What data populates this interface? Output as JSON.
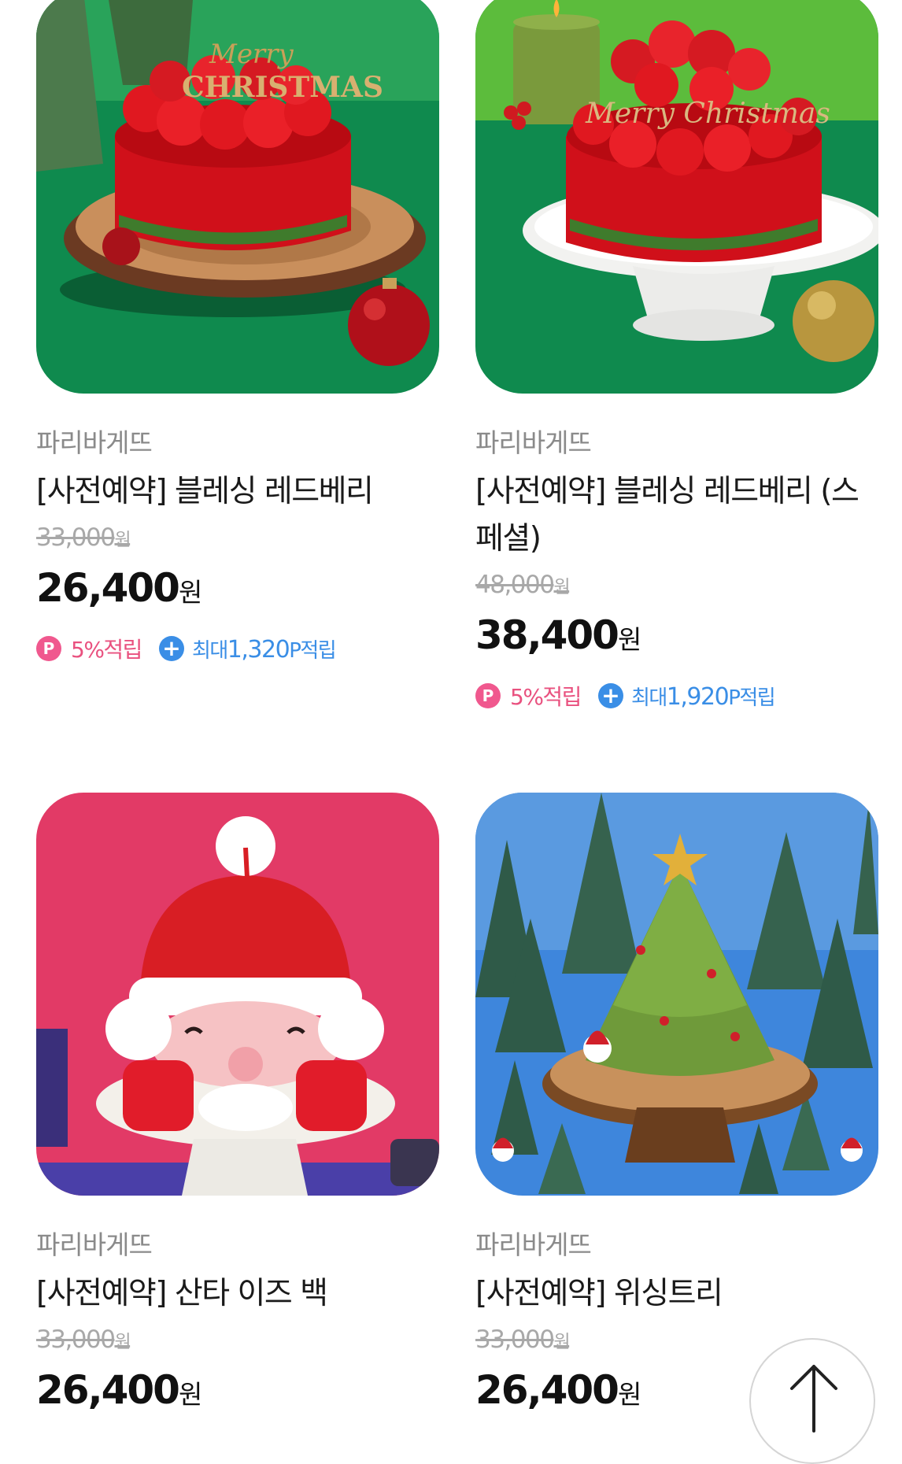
{
  "products": [
    {
      "brand": "파리바게뜨",
      "title": "[사전예약] 블레싱 레드베리",
      "original_price": "33,000",
      "price": "26,400",
      "currency": "원",
      "point_icon": "P",
      "point_rate": "5%적립",
      "bonus_prefix": "최대",
      "bonus_amount": "1,320",
      "bonus_suffix": "P적립",
      "image": "red-berry-cake-on-wood",
      "merry_text": "Merry",
      "christmas_text": "CHRISTMAS"
    },
    {
      "brand": "파리바게뜨",
      "title": "[사전예약] 블레싱 레드베리 (스페셜)",
      "original_price": "48,000",
      "price": "38,400",
      "currency": "원",
      "point_icon": "P",
      "point_rate": "5%적립",
      "bonus_prefix": "최대",
      "bonus_amount": "1,920",
      "bonus_suffix": "P적립",
      "image": "red-berry-cake-on-stand",
      "topper_text": "Merry Christmas"
    },
    {
      "brand": "파리바게뜨",
      "title": "[사전예약] 산타 이즈 백",
      "original_price": "33,000",
      "price": "26,400",
      "currency": "원",
      "image": "santa-cake"
    },
    {
      "brand": "파리바게뜨",
      "title": "[사전예약] 위싱트리",
      "original_price": "33,000",
      "price": "26,400",
      "currency": "원",
      "image": "tree-cake"
    }
  ],
  "scroll_top_icon": "arrow-up-icon",
  "colors": {
    "point_pink": "#f0588e",
    "bonus_blue": "#3a8ee6"
  }
}
